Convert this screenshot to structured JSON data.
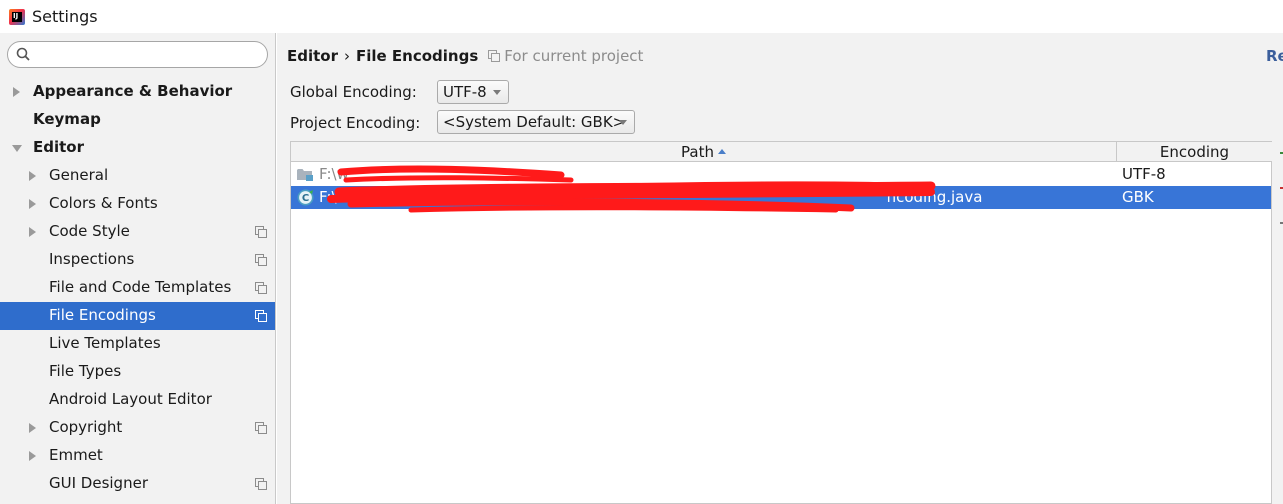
{
  "window": {
    "title": "Settings"
  },
  "search": {
    "placeholder": "",
    "value": ""
  },
  "sidebar": {
    "items": [
      {
        "label": "Appearance & Behavior",
        "level": 0,
        "bold": true,
        "arrow": "collapsed",
        "project": false,
        "selected": false
      },
      {
        "label": "Keymap",
        "level": 0,
        "bold": true,
        "arrow": "none",
        "project": false,
        "selected": false
      },
      {
        "label": "Editor",
        "level": 0,
        "bold": true,
        "arrow": "expanded",
        "project": false,
        "selected": false
      },
      {
        "label": "General",
        "level": 1,
        "bold": false,
        "arrow": "collapsed",
        "project": false,
        "selected": false
      },
      {
        "label": "Colors & Fonts",
        "level": 1,
        "bold": false,
        "arrow": "collapsed",
        "project": false,
        "selected": false
      },
      {
        "label": "Code Style",
        "level": 1,
        "bold": false,
        "arrow": "collapsed",
        "project": true,
        "selected": false
      },
      {
        "label": "Inspections",
        "level": 1,
        "bold": false,
        "arrow": "none",
        "project": true,
        "selected": false
      },
      {
        "label": "File and Code Templates",
        "level": 1,
        "bold": false,
        "arrow": "none",
        "project": true,
        "selected": false
      },
      {
        "label": "File Encodings",
        "level": 1,
        "bold": false,
        "arrow": "none",
        "project": true,
        "selected": true
      },
      {
        "label": "Live Templates",
        "level": 1,
        "bold": false,
        "arrow": "none",
        "project": false,
        "selected": false
      },
      {
        "label": "File Types",
        "level": 1,
        "bold": false,
        "arrow": "none",
        "project": false,
        "selected": false
      },
      {
        "label": "Android Layout Editor",
        "level": 1,
        "bold": false,
        "arrow": "none",
        "project": false,
        "selected": false
      },
      {
        "label": "Copyright",
        "level": 1,
        "bold": false,
        "arrow": "collapsed",
        "project": true,
        "selected": false
      },
      {
        "label": "Emmet",
        "level": 1,
        "bold": false,
        "arrow": "collapsed",
        "project": false,
        "selected": false
      },
      {
        "label": "GUI Designer",
        "level": 1,
        "bold": false,
        "arrow": "none",
        "project": true,
        "selected": false
      }
    ]
  },
  "header": {
    "breadcrumb": [
      "Editor",
      "File Encodings"
    ],
    "separator": "›",
    "scope": "For current project",
    "reset": "Re"
  },
  "settings": {
    "global_encoding_label": "Global Encoding:",
    "global_encoding_value": "UTF-8",
    "project_encoding_label": "Project Encoding:",
    "project_encoding_value": "<System Default: GBK>"
  },
  "table": {
    "columns": {
      "path": "Path",
      "encoding": "Encoding"
    },
    "sort": "ascending",
    "rows": [
      {
        "icon": "folder-icon",
        "path": "F:\\w",
        "encoding": "UTF-8",
        "selected": false
      },
      {
        "icon": "java-class-icon",
        "path": "F:\\",
        "path_suffix": "ncoding.java",
        "encoding": "GBK",
        "selected": true
      }
    ]
  },
  "colors": {
    "selection": "#2f6dcc",
    "table_selection": "#3875d7",
    "redaction": "#ff1a1a",
    "panel_bg": "#f2f2f2"
  }
}
